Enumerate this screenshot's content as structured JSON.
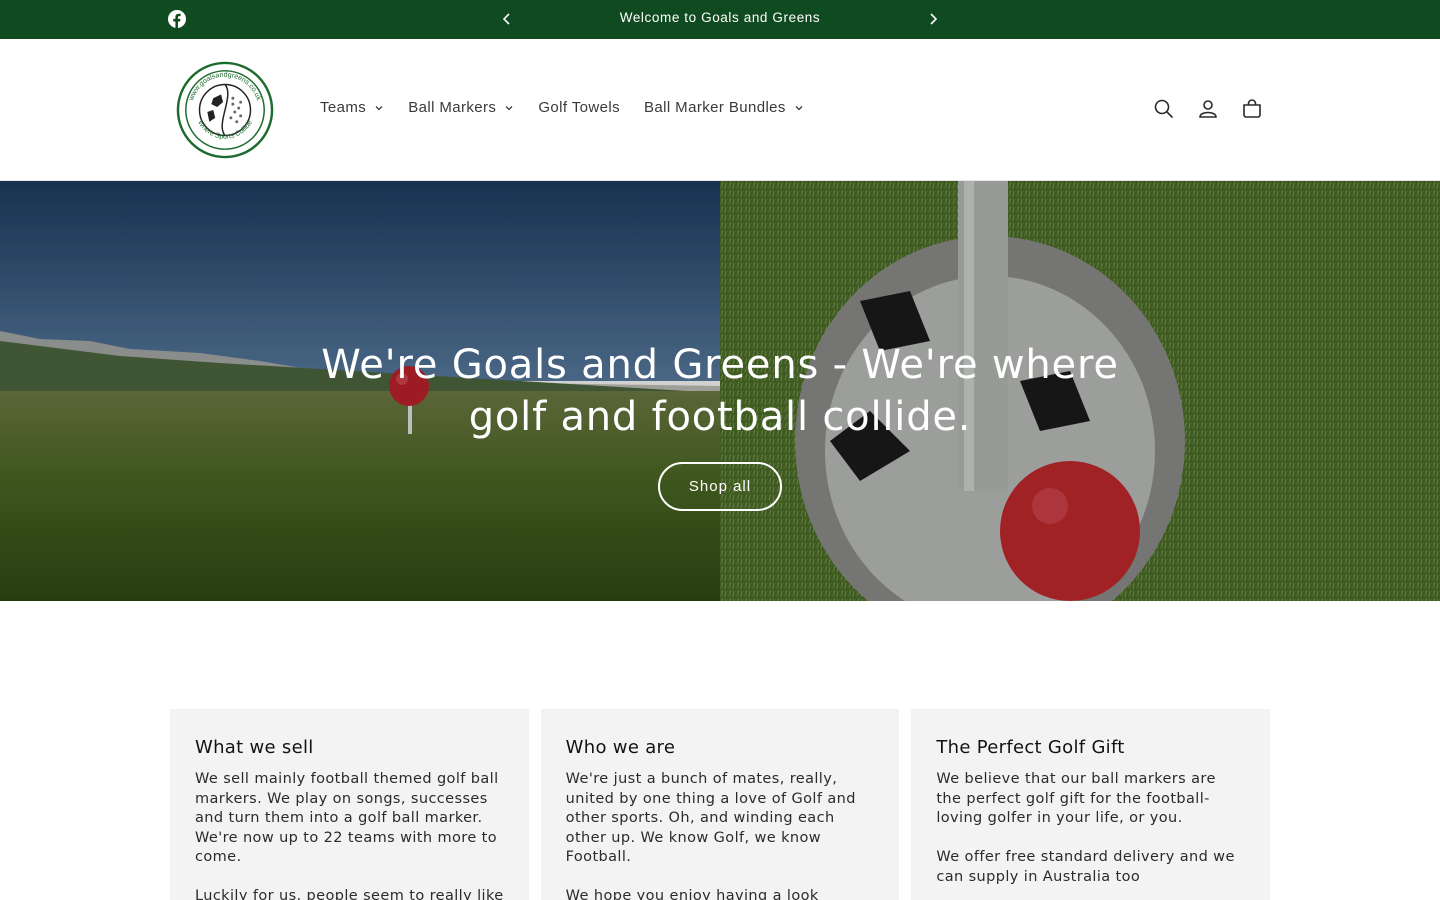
{
  "announcement": {
    "message": "Welcome to Goals and Greens",
    "bg_color": "#0f4a20"
  },
  "header": {
    "logo_text_top": "www.goalsandgreens.co.uk",
    "logo_text_bottom": "Where Sports Collide",
    "nav": [
      {
        "label": "Teams",
        "has_dropdown": true
      },
      {
        "label": "Ball Markers",
        "has_dropdown": true
      },
      {
        "label": "Golf Towels",
        "has_dropdown": false
      },
      {
        "label": "Ball Marker Bundles",
        "has_dropdown": true
      }
    ],
    "icons": [
      "search-icon",
      "account-icon",
      "cart-icon"
    ]
  },
  "hero": {
    "title": "We're Goals and Greens - We're where golf and football collide.",
    "button_label": "Shop all"
  },
  "cards": [
    {
      "title": "What we sell",
      "paragraphs": [
        "We sell mainly football themed golf ball markers. We play on songs, successes and turn them into a golf ball marker. We're now up to 22 teams with more to come.",
        "Luckily for us, people seem to really like"
      ]
    },
    {
      "title": "Who we are",
      "paragraphs": [
        "We're just a bunch of mates, really, united by one thing a love of Golf and other sports. Oh, and winding each other up. We know Golf, we know Football.",
        "We hope you enjoy having a look through the site."
      ]
    },
    {
      "title": "The Perfect Golf Gift",
      "paragraphs": [
        "We believe that our ball markers are the perfect golf gift for the football-loving golfer in your life, or you.",
        "We offer free standard delivery and we can supply in Australia too"
      ]
    }
  ]
}
